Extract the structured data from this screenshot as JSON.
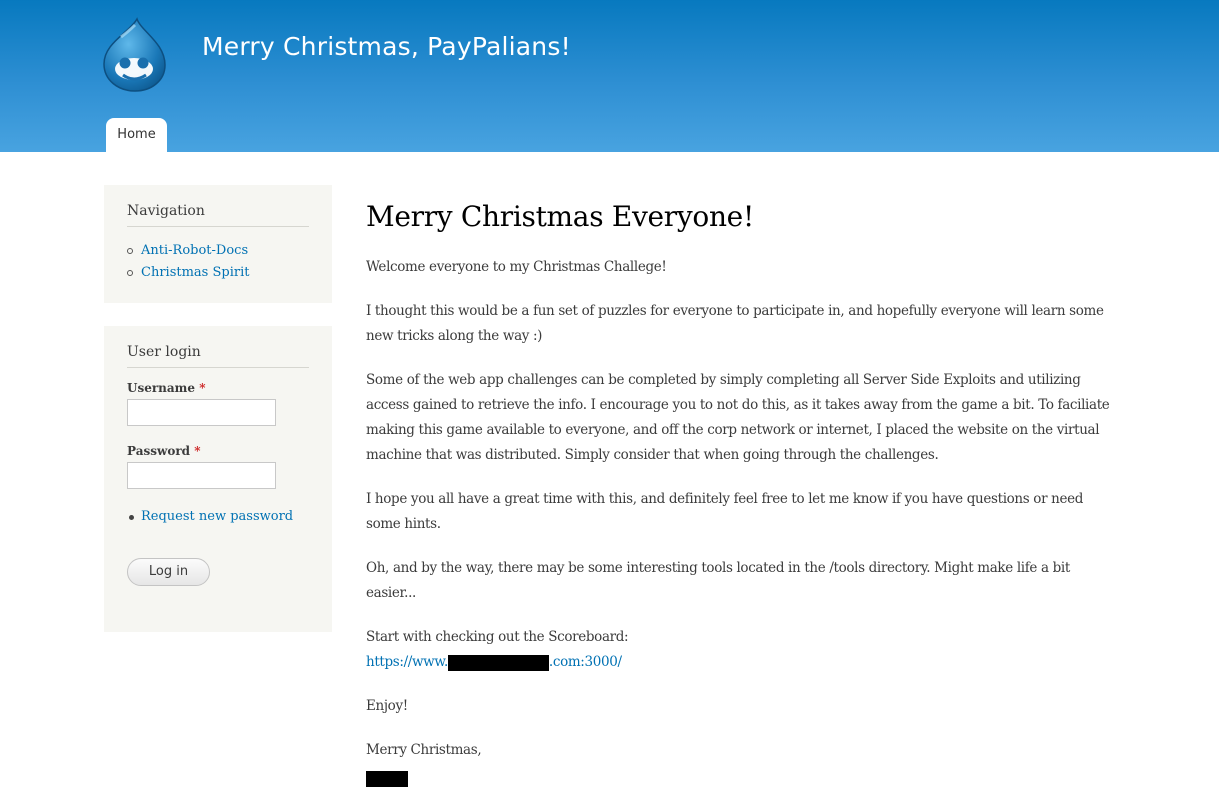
{
  "header": {
    "site_name": "Merry Christmas, PayPalians!",
    "logo_icon": "drupal-drop-logo-icon",
    "tabs": [
      {
        "label": "Home"
      }
    ]
  },
  "sidebar": {
    "navigation": {
      "title": "Navigation",
      "items": [
        {
          "label": "Anti-Robot-Docs"
        },
        {
          "label": "Christmas Spirit"
        }
      ]
    },
    "login": {
      "title": "User login",
      "username_label": "Username",
      "username_value": "",
      "password_label": "Password",
      "password_value": "",
      "required_marker": "*",
      "request_password_link": "Request new password",
      "login_button": "Log in"
    }
  },
  "content": {
    "title": "Merry Christmas Everyone!",
    "paragraphs": [
      "Welcome everyone to my Christmas Challege!",
      "I thought this would be a fun set of puzzles for everyone to participate in, and hopefully everyone will learn some new tricks along the way :)",
      "Some of the web app challenges can be completed by simply completing all Server Side Exploits and utilizing access gained to retrieve the info. I encourage you to not do this, as it takes away from the game a bit. To faciliate making this game available to everyone, and off the corp network or internet, I placed the website on the virtual machine that was distributed. Simply consider that when going through the challenges.",
      "I hope you all have a great time with this, and definitely feel free to let me know if you have questions or need some hints.",
      "Oh, and by the way, there may be some interesting tools located in the /tools directory. Might make life a bit easier..."
    ],
    "scoreboard_intro": "Start with checking out the Scoreboard:",
    "scoreboard_url_prefix": "https://www.",
    "scoreboard_url_suffix": ".com:3000/",
    "enjoy": "Enjoy!",
    "signoff": "Merry Christmas,"
  },
  "colors": {
    "header_top": "#0779bf",
    "header_bottom": "#48a3e0",
    "link": "#0071b3",
    "sidebar_bg": "#f6f6f2"
  }
}
